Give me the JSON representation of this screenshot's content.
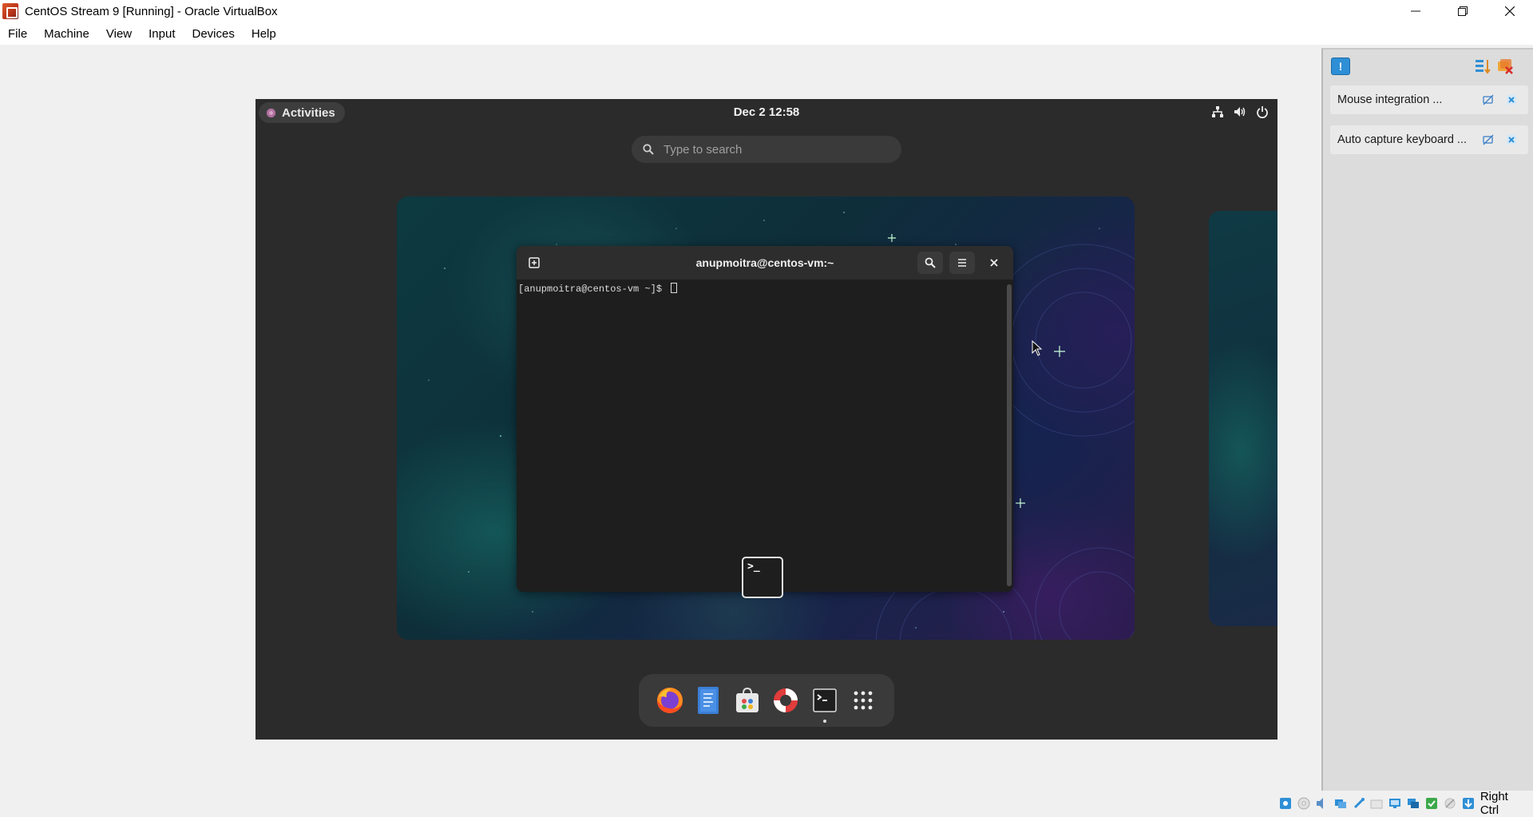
{
  "window": {
    "title": "CentOS Stream 9 [Running] - Oracle VirtualBox",
    "controls": {
      "minimize": "—",
      "restore": "❐",
      "close": "✕"
    }
  },
  "menubar": {
    "items": [
      "File",
      "Machine",
      "View",
      "Input",
      "Devices",
      "Help"
    ]
  },
  "guest": {
    "activities_label": "Activities",
    "clock": "Dec 2  12:58",
    "search_placeholder": "Type to search",
    "terminal": {
      "title": "anupmoitra@centos-vm:~",
      "prompt": "[anupmoitra@centos-vm ~]$ "
    },
    "dock": {
      "items": [
        "firefox-icon",
        "text-editor-icon",
        "software-icon",
        "help-icon",
        "terminal-icon",
        "app-grid-icon"
      ]
    }
  },
  "notifications": {
    "items": [
      {
        "label": "Mouse integration ..."
      },
      {
        "label": "Auto capture keyboard ..."
      }
    ]
  },
  "statusbar": {
    "host_key": "Right Ctrl"
  },
  "colors": {
    "vm_background": "#2b2b2b",
    "terminal_background": "#1e1e1e",
    "accent_blue": "#2e8fd6"
  }
}
